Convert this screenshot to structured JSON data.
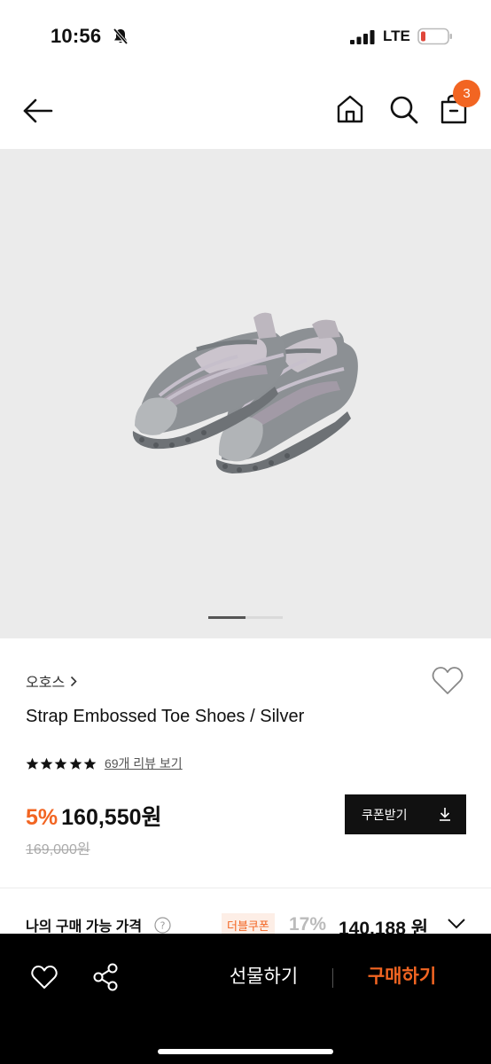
{
  "status_bar": {
    "time": "10:56",
    "network": "LTE",
    "icons": [
      "bell-slash-icon",
      "signal-icon",
      "battery-low-icon"
    ],
    "battery_color": "#e0463a"
  },
  "header": {
    "icons": [
      "back-arrow-icon",
      "home-icon",
      "search-icon",
      "shopping-bag-icon"
    ],
    "cart_badge": "3"
  },
  "product": {
    "image": "silver-strap-shoes",
    "gallery_pages": 2,
    "gallery_current": 1,
    "brand": "오호스",
    "title": "Strap Embossed Toe Shoes / Silver",
    "rating_stars": 5,
    "review_link": "69개 리뷰 보기",
    "discount_rate": "5%",
    "price": "160,550원",
    "original_price": "169,000원",
    "coupon_label": "쿠폰받기",
    "my_price": {
      "label": "나의 구매 가능 가격",
      "badge": "더블쿠폰",
      "discount_rate": "17%",
      "price": "140,188 원"
    }
  },
  "bottom_bar": {
    "gift_label": "선물하기",
    "buy_label": "구매하기"
  },
  "colors": {
    "accent": "#f26522",
    "gallery_background": "#ebebeb"
  }
}
